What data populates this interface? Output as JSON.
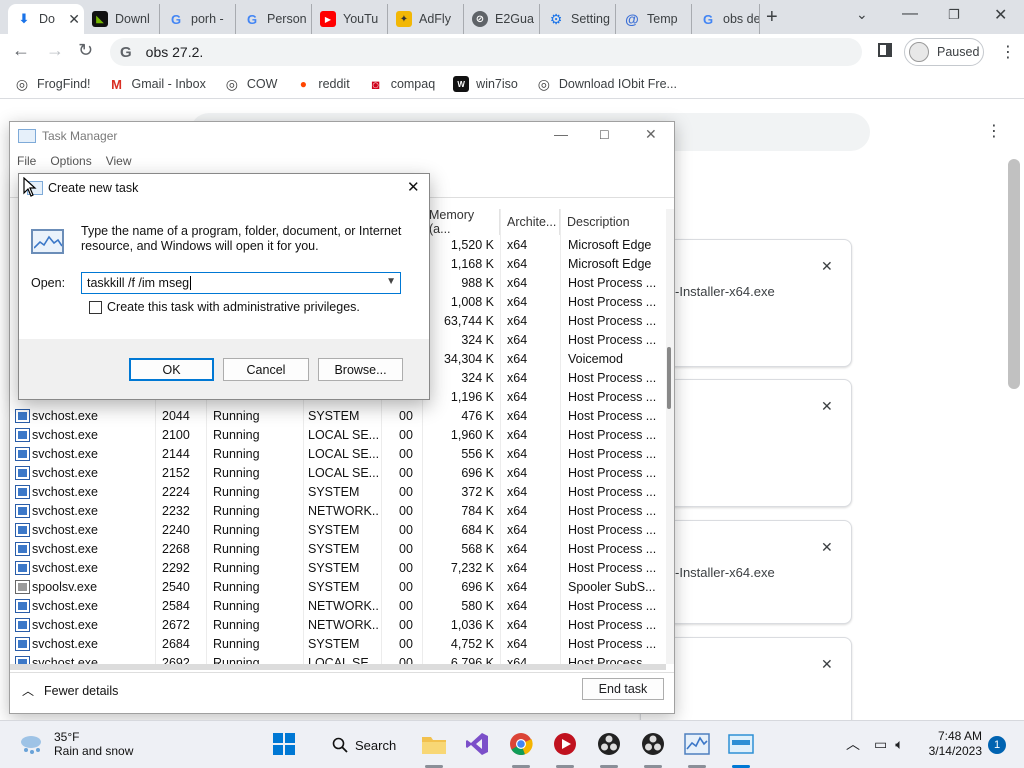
{
  "browser": {
    "tabs": [
      {
        "label": "Do",
        "active": true,
        "icon": "download-icon"
      },
      {
        "label": "Downl",
        "icon": "nvidia-icon"
      },
      {
        "label": "porh -",
        "icon": "google-icon"
      },
      {
        "label": "Person",
        "icon": "google-icon"
      },
      {
        "label": "YouTu",
        "icon": "youtube-icon"
      },
      {
        "label": "AdFly",
        "icon": "adfly-icon"
      },
      {
        "label": "E2Gua",
        "icon": "e2guardian-icon"
      },
      {
        "label": "Setting",
        "icon": "gear-icon"
      },
      {
        "label": "Temp",
        "icon": "at-icon"
      },
      {
        "label": "obs de",
        "icon": "google-icon"
      }
    ],
    "new_tab": "+",
    "address": "obs 27.2.",
    "profile_status": "Paused",
    "bookmarks": [
      {
        "label": "FrogFind!",
        "icon": "globe-icon"
      },
      {
        "label": "Gmail - Inbox",
        "icon": "gmail-icon"
      },
      {
        "label": "COW",
        "icon": "globe-icon"
      },
      {
        "label": "reddit",
        "icon": "reddit-icon"
      },
      {
        "label": "compaq",
        "icon": "compaq-icon"
      },
      {
        "label": "win7iso",
        "icon": "win7iso-icon"
      },
      {
        "label": "Download IObit Fre...",
        "icon": "globe-icon"
      }
    ]
  },
  "downloads_page": {
    "cards": [
      {
        "name": "-Installer-x64.exe"
      },
      {
        "name": ""
      },
      {
        "name": "-Installer-x64.exe"
      },
      {
        "name": ""
      }
    ]
  },
  "task_manager": {
    "title": "Task Manager",
    "menu": [
      "File",
      "Options",
      "View"
    ],
    "columns": [
      {
        "label": "Memory (a..."
      },
      {
        "label": "Archite..."
      },
      {
        "label": "Description"
      }
    ],
    "rows": [
      {
        "name": "",
        "pid": "",
        "status": "",
        "user": "",
        "cpu": "",
        "mem": "1,520 K",
        "arch": "x64",
        "desc": "Microsoft Edge"
      },
      {
        "name": "",
        "pid": "",
        "status": "",
        "user": "",
        "cpu": "",
        "mem": "1,168 K",
        "arch": "x64",
        "desc": "Microsoft Edge"
      },
      {
        "name": "",
        "pid": "",
        "status": "",
        "user": "",
        "cpu": "",
        "mem": "988 K",
        "arch": "x64",
        "desc": "Host Process ..."
      },
      {
        "name": "",
        "pid": "",
        "status": "",
        "user": "",
        "cpu": "",
        "mem": "1,008 K",
        "arch": "x64",
        "desc": "Host Process ..."
      },
      {
        "name": "",
        "pid": "",
        "status": "",
        "user": "",
        "cpu": "",
        "mem": "63,744 K",
        "arch": "x64",
        "desc": "Host Process ..."
      },
      {
        "name": "",
        "pid": "",
        "status": "",
        "user": "",
        "cpu": "",
        "mem": "324 K",
        "arch": "x64",
        "desc": "Host Process ..."
      },
      {
        "name": "",
        "pid": "",
        "status": "",
        "user": "",
        "cpu": "",
        "mem": "34,304 K",
        "arch": "x64",
        "desc": "Voicemod"
      },
      {
        "name": "",
        "pid": "",
        "status": "",
        "user": "",
        "cpu": "",
        "mem": "324 K",
        "arch": "x64",
        "desc": "Host Process ..."
      },
      {
        "name": "",
        "pid": "",
        "status": "",
        "user": "",
        "cpu": "",
        "mem": "1,196 K",
        "arch": "x64",
        "desc": "Host Process ..."
      },
      {
        "name": "svchost.exe",
        "pid": "2044",
        "status": "Running",
        "user": "SYSTEM",
        "cpu": "00",
        "mem": "476 K",
        "arch": "x64",
        "desc": "Host Process ..."
      },
      {
        "name": "svchost.exe",
        "pid": "2100",
        "status": "Running",
        "user": "LOCAL SE...",
        "cpu": "00",
        "mem": "1,960 K",
        "arch": "x64",
        "desc": "Host Process ..."
      },
      {
        "name": "svchost.exe",
        "pid": "2144",
        "status": "Running",
        "user": "LOCAL SE...",
        "cpu": "00",
        "mem": "556 K",
        "arch": "x64",
        "desc": "Host Process ..."
      },
      {
        "name": "svchost.exe",
        "pid": "2152",
        "status": "Running",
        "user": "LOCAL SE...",
        "cpu": "00",
        "mem": "696 K",
        "arch": "x64",
        "desc": "Host Process ..."
      },
      {
        "name": "svchost.exe",
        "pid": "2224",
        "status": "Running",
        "user": "SYSTEM",
        "cpu": "00",
        "mem": "372 K",
        "arch": "x64",
        "desc": "Host Process ..."
      },
      {
        "name": "svchost.exe",
        "pid": "2232",
        "status": "Running",
        "user": "NETWORK...",
        "cpu": "00",
        "mem": "784 K",
        "arch": "x64",
        "desc": "Host Process ..."
      },
      {
        "name": "svchost.exe",
        "pid": "2240",
        "status": "Running",
        "user": "SYSTEM",
        "cpu": "00",
        "mem": "684 K",
        "arch": "x64",
        "desc": "Host Process ..."
      },
      {
        "name": "svchost.exe",
        "pid": "2268",
        "status": "Running",
        "user": "SYSTEM",
        "cpu": "00",
        "mem": "568 K",
        "arch": "x64",
        "desc": "Host Process ..."
      },
      {
        "name": "svchost.exe",
        "pid": "2292",
        "status": "Running",
        "user": "SYSTEM",
        "cpu": "00",
        "mem": "7,232 K",
        "arch": "x64",
        "desc": "Host Process ..."
      },
      {
        "name": "spoolsv.exe",
        "pid": "2540",
        "status": "Running",
        "user": "SYSTEM",
        "cpu": "00",
        "mem": "696 K",
        "arch": "x64",
        "desc": "Spooler SubS..."
      },
      {
        "name": "svchost.exe",
        "pid": "2584",
        "status": "Running",
        "user": "NETWORK...",
        "cpu": "00",
        "mem": "580 K",
        "arch": "x64",
        "desc": "Host Process ..."
      },
      {
        "name": "svchost.exe",
        "pid": "2672",
        "status": "Running",
        "user": "NETWORK...",
        "cpu": "00",
        "mem": "1,036 K",
        "arch": "x64",
        "desc": "Host Process ..."
      },
      {
        "name": "svchost.exe",
        "pid": "2684",
        "status": "Running",
        "user": "SYSTEM",
        "cpu": "00",
        "mem": "4,752 K",
        "arch": "x64",
        "desc": "Host Process ..."
      },
      {
        "name": "svchost.exe",
        "pid": "2692",
        "status": "Running",
        "user": "LOCAL SE...",
        "cpu": "00",
        "mem": "6,796 K",
        "arch": "x64",
        "desc": "Host Process ..."
      }
    ],
    "fewer_details": "Fewer details",
    "end_task": "End task"
  },
  "dialog": {
    "title": "Create new task",
    "message": "Type the name of a program, folder, document, or Internet resource, and Windows will open it for you.",
    "open_label": "Open:",
    "open_value": "taskkill /f /im mseg",
    "admin_checkbox": "Create this task with administrative privileges.",
    "ok": "OK",
    "cancel": "Cancel",
    "browse": "Browse..."
  },
  "taskbar": {
    "weather_temp": "35°F",
    "weather_desc": "Rain and snow",
    "search": "Search",
    "time": "7:48 AM",
    "date": "3/14/2023",
    "notifications": "1"
  },
  "colors": {
    "accent": "#0078d4",
    "chrome_tabstrip": "#dee1e6",
    "taskbar": "#eef0f5"
  }
}
